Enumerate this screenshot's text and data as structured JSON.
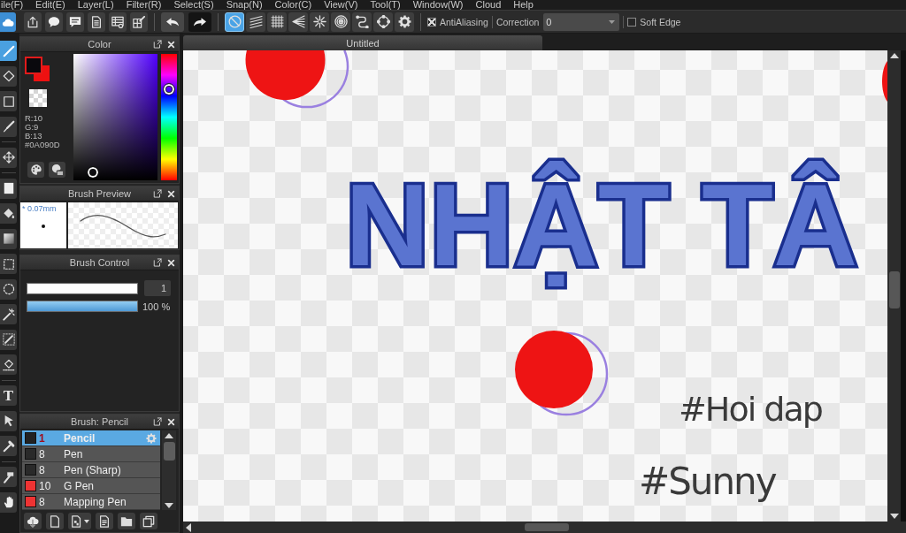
{
  "menu_bar": {
    "items": [
      "ile(F)",
      "Edit(E)",
      "Layer(L)",
      "Filter(R)",
      "Select(S)",
      "Snap(N)",
      "Color(C)",
      "View(V)",
      "Tool(T)",
      "Window(W)",
      "Cloud",
      "Help"
    ]
  },
  "toolbar": {
    "file_buttons": [
      {
        "kind": "cloud"
      },
      {
        "kind": "share"
      },
      {
        "kind": "bubble"
      },
      {
        "kind": "message"
      },
      {
        "kind": "page"
      },
      {
        "kind": "table"
      },
      {
        "kind": "table-edit"
      }
    ],
    "history_buttons": [
      {
        "kind": "undo"
      },
      {
        "kind": "redo"
      }
    ],
    "snap_buttons": [
      {
        "kind": "off",
        "selected": true
      },
      {
        "kind": "parallel",
        "selected": false
      },
      {
        "kind": "grid",
        "selected": false
      },
      {
        "kind": "perspective",
        "selected": false
      },
      {
        "kind": "radial",
        "selected": false
      },
      {
        "kind": "concentric",
        "selected": false
      },
      {
        "kind": "curve",
        "selected": false
      },
      {
        "kind": "ellipse",
        "selected": false
      },
      {
        "kind": "settings",
        "selected": false
      }
    ],
    "antialiasing": {
      "label": "AntiAliasing",
      "checked": true
    },
    "correction": {
      "label": "Correction",
      "value": "0"
    },
    "soft_edge": {
      "label": "Soft Edge",
      "checked": false
    }
  },
  "tool_groups": [
    {
      "tools": [
        {
          "kind": "pen",
          "selected": true
        },
        {
          "kind": "eraser",
          "selected": false
        },
        {
          "kind": "shape",
          "selected": false
        },
        {
          "kind": "brush",
          "selected": false
        }
      ]
    },
    {
      "tools": [
        {
          "kind": "move",
          "selected": false
        }
      ]
    },
    {
      "tools": [
        {
          "kind": "fill",
          "selected": false
        },
        {
          "kind": "bucket",
          "selected": false
        },
        {
          "kind": "gradient",
          "selected": false
        },
        {
          "kind": "select-rect",
          "selected": false
        },
        {
          "kind": "lasso",
          "selected": false
        },
        {
          "kind": "wand",
          "selected": false
        },
        {
          "kind": "select-pen",
          "selected": false
        },
        {
          "kind": "select-eraser",
          "selected": false
        }
      ]
    },
    {
      "tools": [
        {
          "kind": "text",
          "glyph": "T",
          "selected": false
        },
        {
          "kind": "operation",
          "selected": false
        },
        {
          "kind": "eyedropper",
          "selected": false
        }
      ]
    },
    {
      "tools": [
        {
          "kind": "hammer",
          "selected": false
        },
        {
          "kind": "hand",
          "selected": false
        }
      ]
    }
  ],
  "color_panel": {
    "title": "Color",
    "swatches": [
      {
        "kind": "foreground",
        "color": "#0a090d"
      },
      {
        "kind": "background",
        "color": "#ee1111"
      },
      {
        "kind": "transparent"
      }
    ],
    "readout": [
      "R:10",
      "G:9",
      "B:13",
      "#0A090D"
    ],
    "buttons": [
      {
        "kind": "palette"
      },
      {
        "kind": "palette-card"
      }
    ],
    "hue_slider": {
      "level": 0.72
    }
  },
  "brush_preview": {
    "title": "Brush Preview",
    "size_label": "* 0.07mm"
  },
  "brush_control": {
    "title": "Brush Control",
    "size": {
      "level": 1,
      "value": "1"
    },
    "opacity": {
      "level": 1,
      "reading": "100 %"
    }
  },
  "brush_list": {
    "title": "Brush: Pencil",
    "items": [
      {
        "color": "#222222",
        "size": "1",
        "name": "Pencil",
        "selected": true
      },
      {
        "color": "#2a2a2a",
        "size": "8",
        "name": "Pen",
        "selected": false
      },
      {
        "color": "#2a2a2a",
        "size": "8",
        "name": "Pen (Sharp)",
        "selected": false
      },
      {
        "color": "#ee3333",
        "size": "10",
        "name": "G Pen",
        "selected": false
      },
      {
        "color": "#ee3333",
        "size": "8",
        "name": "Mapping Pen",
        "selected": false
      }
    ],
    "actions": [
      {
        "kind": "cloud-download"
      },
      {
        "kind": "new"
      },
      {
        "kind": "add-menu"
      },
      {
        "kind": "script"
      },
      {
        "kind": "folder"
      },
      {
        "kind": "duplicate"
      }
    ]
  },
  "canvas": {
    "tabs": [
      {
        "label": "Untitled",
        "selected": true
      }
    ],
    "artwork": {
      "title": "NHẬT TÂ",
      "notes": [
        "#Hoi dap",
        "#Sunny"
      ]
    }
  }
}
